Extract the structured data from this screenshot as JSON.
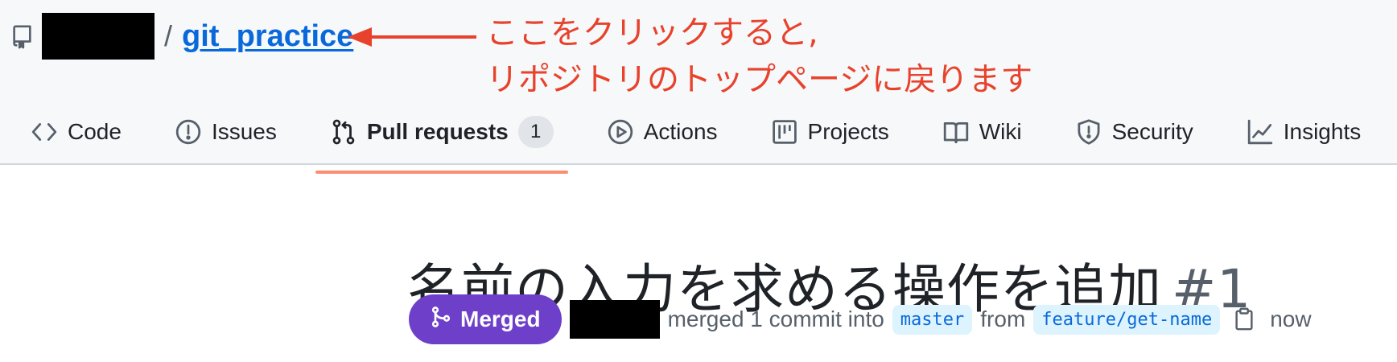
{
  "repo": {
    "owner_label": "",
    "separator": "/",
    "name": "git_practice"
  },
  "annotation": {
    "line1": "ここをクリックすると,",
    "line2": "リポジトリのトップページに戻ります",
    "color": "#e8422c"
  },
  "tabs": [
    {
      "label": "Code",
      "icon": "code-icon"
    },
    {
      "label": "Issues",
      "icon": "issue-icon"
    },
    {
      "label": "Pull requests",
      "icon": "pull-request-icon",
      "counter": "1",
      "active": true
    },
    {
      "label": "Actions",
      "icon": "play-icon"
    },
    {
      "label": "Projects",
      "icon": "project-table-icon"
    },
    {
      "label": "Wiki",
      "icon": "book-icon"
    },
    {
      "label": "Security",
      "icon": "shield-icon"
    },
    {
      "label": "Insights",
      "icon": "graph-icon"
    }
  ],
  "pr": {
    "title": "名前の入力を求める操作を追加",
    "number": "#1",
    "status": "Merged",
    "status_color": "#6e40c9",
    "summary": "merged 1 commit into",
    "base_branch": "master",
    "from_label": "from",
    "head_branch": "feature/get-name",
    "time": "now"
  },
  "colors": {
    "link": "#0969da",
    "active_tab_underline": "#fd8c73",
    "header_bg": "#f6f8fa"
  }
}
